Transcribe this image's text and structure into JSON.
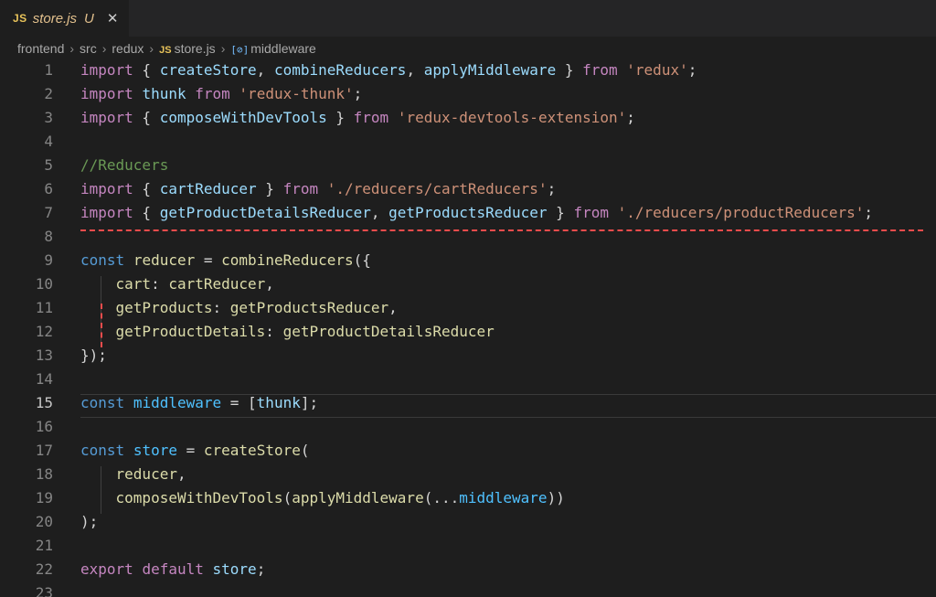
{
  "tab": {
    "badge": "JS",
    "filename": "store.js",
    "status": "U",
    "close": "✕"
  },
  "breadcrumb": {
    "items": [
      "frontend",
      "src",
      "redux"
    ],
    "file_badge": "JS",
    "file": "store.js",
    "symbol_icon": "[⊘]",
    "symbol": "middleware",
    "separator": "›"
  },
  "editor": {
    "active_line": "15",
    "lines": [
      {
        "n": "1",
        "tokens": [
          [
            "kw",
            "import"
          ],
          [
            "pun",
            " { "
          ],
          [
            "var",
            "createStore"
          ],
          [
            "pun",
            ", "
          ],
          [
            "var",
            "combineReducers"
          ],
          [
            "pun",
            ", "
          ],
          [
            "var",
            "applyMiddleware"
          ],
          [
            "pun",
            " } "
          ],
          [
            "kw",
            "from"
          ],
          [
            "pun",
            " "
          ],
          [
            "str",
            "'redux'"
          ],
          [
            "pun",
            ";"
          ]
        ]
      },
      {
        "n": "2",
        "tokens": [
          [
            "kw",
            "import"
          ],
          [
            "pun",
            " "
          ],
          [
            "var",
            "thunk"
          ],
          [
            "pun",
            " "
          ],
          [
            "kw",
            "from"
          ],
          [
            "pun",
            " "
          ],
          [
            "str",
            "'redux-thunk'"
          ],
          [
            "pun",
            ";"
          ]
        ]
      },
      {
        "n": "3",
        "tokens": [
          [
            "kw",
            "import"
          ],
          [
            "pun",
            " { "
          ],
          [
            "var",
            "composeWithDevTools"
          ],
          [
            "pun",
            " } "
          ],
          [
            "kw",
            "from"
          ],
          [
            "pun",
            " "
          ],
          [
            "str",
            "'redux-devtools-extension'"
          ],
          [
            "pun",
            ";"
          ]
        ]
      },
      {
        "n": "4",
        "tokens": []
      },
      {
        "n": "5",
        "tokens": [
          [
            "cmt",
            "//Reducers"
          ]
        ]
      },
      {
        "n": "6",
        "tokens": [
          [
            "kw",
            "import"
          ],
          [
            "pun",
            " { "
          ],
          [
            "var",
            "cartReducer"
          ],
          [
            "pun",
            " } "
          ],
          [
            "kw",
            "from"
          ],
          [
            "pun",
            " "
          ],
          [
            "str",
            "'./reducers/cartReducers'"
          ],
          [
            "pun",
            ";"
          ]
        ]
      },
      {
        "n": "7",
        "tokens": [
          [
            "kw",
            "import"
          ],
          [
            "pun",
            " { "
          ],
          [
            "var",
            "getProductDetailsReducer"
          ],
          [
            "pun",
            ", "
          ],
          [
            "var",
            "getProductsReducer"
          ],
          [
            "pun",
            " } "
          ],
          [
            "kw",
            "from"
          ],
          [
            "pun",
            " "
          ],
          [
            "str",
            "'./reducers/productReducers'"
          ],
          [
            "pun",
            ";"
          ]
        ]
      },
      {
        "n": "8",
        "tokens": []
      },
      {
        "n": "9",
        "tokens": [
          [
            "st",
            "const"
          ],
          [
            "pun",
            " "
          ],
          [
            "fn",
            "reducer"
          ],
          [
            "pun",
            " = "
          ],
          [
            "fn",
            "combineReducers"
          ],
          [
            "pun",
            "({"
          ]
        ]
      },
      {
        "n": "10",
        "tokens": [
          [
            "pun",
            "    "
          ],
          [
            "fn",
            "cart"
          ],
          [
            "pun",
            ": "
          ],
          [
            "fn",
            "cartReducer"
          ],
          [
            "pun",
            ","
          ]
        ]
      },
      {
        "n": "11",
        "tokens": [
          [
            "pun",
            "    "
          ],
          [
            "fn",
            "getProducts"
          ],
          [
            "pun",
            ": "
          ],
          [
            "fn",
            "getProductsReducer"
          ],
          [
            "pun",
            ","
          ]
        ]
      },
      {
        "n": "12",
        "tokens": [
          [
            "pun",
            "    "
          ],
          [
            "fn",
            "getProductDetails"
          ],
          [
            "pun",
            ": "
          ],
          [
            "fn",
            "getProductDetailsReducer"
          ]
        ]
      },
      {
        "n": "13",
        "tokens": [
          [
            "pun",
            "});"
          ]
        ]
      },
      {
        "n": "14",
        "tokens": []
      },
      {
        "n": "15",
        "tokens": [
          [
            "st",
            "const"
          ],
          [
            "pun",
            " "
          ],
          [
            "cst",
            "middleware"
          ],
          [
            "pun",
            " = ["
          ],
          [
            "var",
            "thunk"
          ],
          [
            "pun",
            "];"
          ]
        ]
      },
      {
        "n": "16",
        "tokens": []
      },
      {
        "n": "17",
        "tokens": [
          [
            "st",
            "const"
          ],
          [
            "pun",
            " "
          ],
          [
            "cst",
            "store"
          ],
          [
            "pun",
            " = "
          ],
          [
            "fn",
            "createStore"
          ],
          [
            "pun",
            "("
          ]
        ]
      },
      {
        "n": "18",
        "tokens": [
          [
            "pun",
            "    "
          ],
          [
            "fn",
            "reducer"
          ],
          [
            "pun",
            ","
          ]
        ]
      },
      {
        "n": "19",
        "tokens": [
          [
            "pun",
            "    "
          ],
          [
            "fn",
            "composeWithDevTools"
          ],
          [
            "pun",
            "("
          ],
          [
            "fn",
            "applyMiddleware"
          ],
          [
            "pun",
            "(..."
          ],
          [
            "cst",
            "middleware"
          ],
          [
            "pun",
            "))"
          ]
        ]
      },
      {
        "n": "20",
        "tokens": [
          [
            "pun",
            ");"
          ]
        ]
      },
      {
        "n": "21",
        "tokens": []
      },
      {
        "n": "22",
        "tokens": [
          [
            "kw",
            "export"
          ],
          [
            "pun",
            " "
          ],
          [
            "kw",
            "default"
          ],
          [
            "pun",
            " "
          ],
          [
            "var",
            "store"
          ],
          [
            "pun",
            ";"
          ]
        ]
      },
      {
        "n": "23",
        "tokens": []
      }
    ]
  },
  "colors": {
    "background": "#1e1e1e",
    "tab_bar": "#252526",
    "keyword": "#c586c0",
    "storage": "#569cd6",
    "function": "#dcdcaa",
    "variable": "#9cdcfe",
    "constant": "#4fc1ff",
    "string": "#ce9178",
    "comment": "#6a9955",
    "error": "#f14c4c",
    "modified_file": "#e2c08d"
  }
}
